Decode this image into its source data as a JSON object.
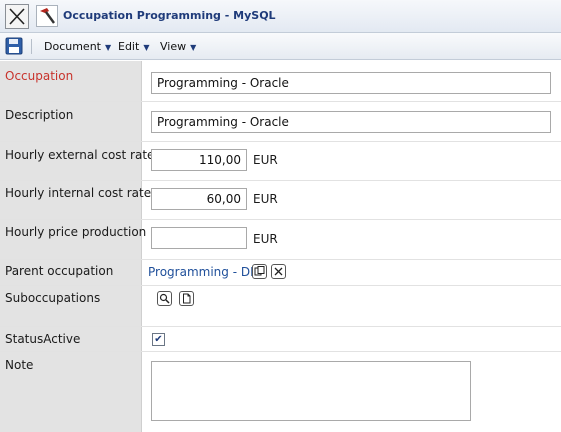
{
  "window": {
    "title": "Occupation Programming - MySQL"
  },
  "toolbar": {
    "menus": [
      {
        "label": "Document"
      },
      {
        "label": "Edit"
      },
      {
        "label": "View"
      }
    ]
  },
  "form": {
    "occupation": {
      "label": "Occupation",
      "value": "Programming - Oracle"
    },
    "description": {
      "label": "Description",
      "value": "Programming - Oracle"
    },
    "hourly_external": {
      "label": "Hourly external cost rate",
      "value": "110,00",
      "unit": "EUR"
    },
    "hourly_internal": {
      "label": "Hourly internal cost rate",
      "value": "60,00",
      "unit": "EUR"
    },
    "hourly_price": {
      "label": "Hourly price production",
      "value": "",
      "unit": "EUR"
    },
    "parent": {
      "label": "Parent occupation",
      "value": "Programming - DB"
    },
    "sub": {
      "label": "Suboccupations"
    },
    "status": {
      "label": "StatusActive",
      "checked": true
    },
    "note": {
      "label": "Note",
      "value": ""
    }
  },
  "icons": {
    "close": "close-x-icon",
    "app": "hammer-icon",
    "save": "floppy-disk-icon",
    "copy": "copy-icon",
    "clear": "clear-x-icon",
    "search": "magnifier-icon",
    "new": "new-document-icon",
    "check": "checkmark-icon"
  }
}
